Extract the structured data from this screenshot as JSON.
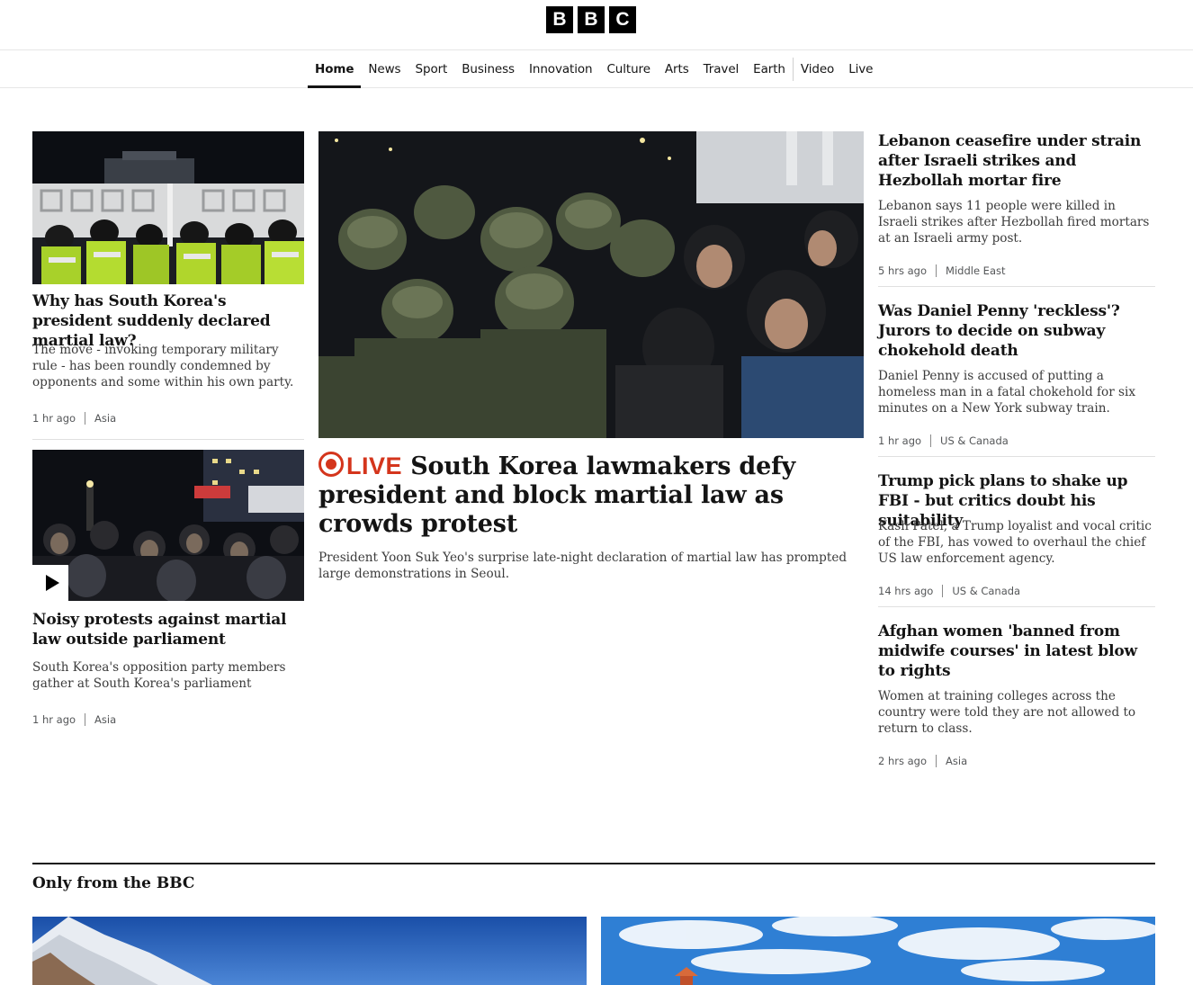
{
  "logo": {
    "letters": [
      "B",
      "B",
      "C"
    ]
  },
  "nav": {
    "items": [
      "Home",
      "News",
      "Sport",
      "Business",
      "Innovation",
      "Culture",
      "Arts",
      "Travel",
      "Earth"
    ],
    "items2": [
      "Video",
      "Live"
    ],
    "active": "Home"
  },
  "stories": {
    "left1": {
      "headline": "Why has South Korea's president suddenly declared martial law?",
      "summary": "The move - invoking temporary military rule - has been roundly condemned by opponents and some within his own party.",
      "time": "1 hr ago",
      "tag": "Asia"
    },
    "left2": {
      "headline": "Noisy protests against martial law outside parliament",
      "summary": "South Korea's opposition party members gather at South Korea's parliament",
      "time": "1 hr ago",
      "tag": "Asia"
    },
    "main": {
      "live_label": "LIVE",
      "headline": "South Korea lawmakers defy president and block martial law as crowds protest",
      "summary": "President Yoon Suk Yeo's surprise late-night declaration of martial law has prompted large demonstrations in Seoul."
    },
    "right": [
      {
        "headline": "Lebanon ceasefire under strain after Israeli strikes and Hezbollah mortar fire",
        "summary": "Lebanon says 11 people were killed in Israeli strikes after Hezbollah fired mortars at an Israeli army post.",
        "time": "5 hrs ago",
        "tag": "Middle East"
      },
      {
        "headline": "Was Daniel Penny 'reckless'? Jurors to decide on subway chokehold death",
        "summary": "Daniel Penny is accused of putting a homeless man in a fatal chokehold for six minutes on a New York subway train.",
        "time": "1 hr ago",
        "tag": "US & Canada"
      },
      {
        "headline": "Trump pick plans to shake up FBI - but critics doubt his suitability",
        "summary": "Kash Patel, a Trump loyalist and vocal critic of the FBI, has vowed to overhaul the chief US law enforcement agency.",
        "time": "14 hrs ago",
        "tag": "US & Canada"
      },
      {
        "headline": "Afghan women 'banned from midwife courses' in latest blow to rights",
        "summary": "Women at training colleges across the country were told they are not allowed to return to class.",
        "time": "2 hrs ago",
        "tag": "Asia"
      }
    ]
  },
  "section": {
    "title": "Only from the BBC"
  },
  "colors": {
    "live": "#d4351c",
    "text": "#141414"
  },
  "icons": {
    "video": "play-icon",
    "live": "live-dot-icon"
  }
}
